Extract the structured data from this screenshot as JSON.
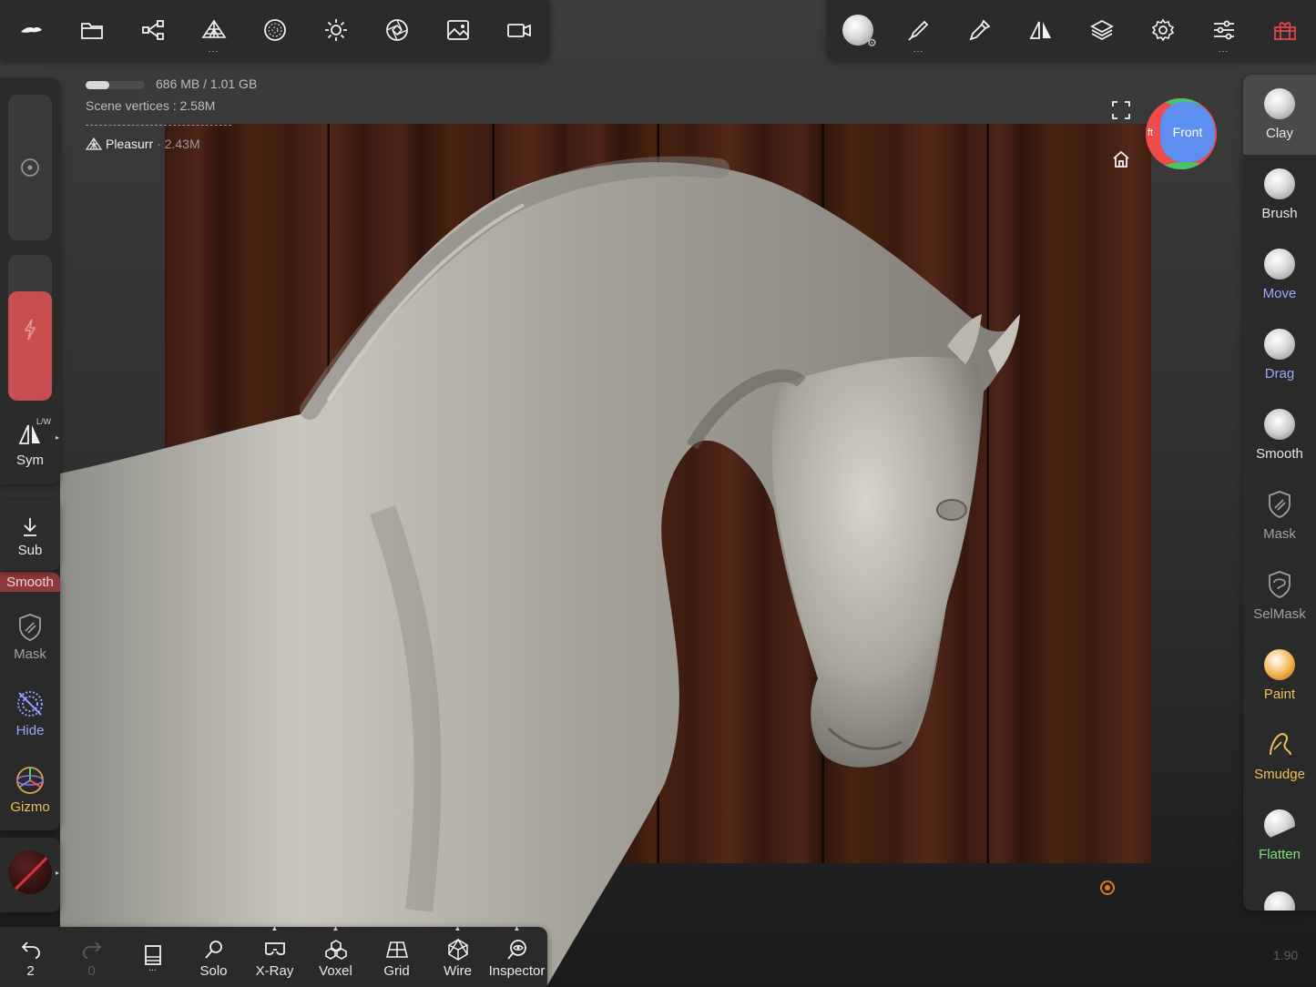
{
  "topbar_left": {
    "items": [
      {
        "name": "nomad-logo-icon"
      },
      {
        "name": "files-icon"
      },
      {
        "name": "scene-tree-icon"
      },
      {
        "name": "topology-icon",
        "more": "..."
      },
      {
        "name": "material-sphere-icon"
      },
      {
        "name": "lighting-icon"
      },
      {
        "name": "postprocess-icon"
      },
      {
        "name": "background-image-icon"
      },
      {
        "name": "camera-icon"
      }
    ]
  },
  "topbar_right": {
    "items": [
      {
        "name": "material-preview-icon"
      },
      {
        "name": "stroke-icon",
        "more": "..."
      },
      {
        "name": "paint-picker-icon"
      },
      {
        "name": "symmetry-icon"
      },
      {
        "name": "layers-icon"
      },
      {
        "name": "settings-icon"
      },
      {
        "name": "interface-sliders-icon",
        "more": "..."
      },
      {
        "name": "gift-icon"
      }
    ]
  },
  "info": {
    "memory": "686 MB / 1.01 GB",
    "memory_fraction": 0.4,
    "scene_vertices_label": "Scene vertices :",
    "scene_vertices_value": "2.58M",
    "mesh_name": "Pleasurr",
    "mesh_count": "· 2.43M"
  },
  "view_cube": {
    "front": "Front",
    "left": "ft"
  },
  "left_panel": {
    "sym": {
      "label": "Sym",
      "badge": "L/W"
    },
    "sub": {
      "label": "Sub"
    },
    "smooth_partial": "Smooth",
    "mask": {
      "label": "Mask"
    },
    "hide": {
      "label": "Hide"
    },
    "gizmo": {
      "label": "Gizmo"
    }
  },
  "right_tools": [
    {
      "label": "Clay",
      "color": "#e6e6e6",
      "active": true
    },
    {
      "label": "Brush",
      "color": "#e6e6e6"
    },
    {
      "label": "Move",
      "color": "#9aa8ff"
    },
    {
      "label": "Drag",
      "color": "#9aa8ff"
    },
    {
      "label": "Smooth",
      "color": "#e6e6e6"
    },
    {
      "label": "Mask",
      "color": "#a0a0a0"
    },
    {
      "label": "SelMask",
      "color": "#a0a0a0"
    },
    {
      "label": "Paint",
      "color": "#f0c050"
    },
    {
      "label": "Smudge",
      "color": "#f0c050"
    },
    {
      "label": "Flatten",
      "color": "#7ee07e"
    }
  ],
  "bottombar": {
    "undo": {
      "label": "2"
    },
    "redo": {
      "label": "0"
    },
    "history_more": "...",
    "solo": {
      "label": "Solo"
    },
    "xray": {
      "label": "X-Ray"
    },
    "voxel": {
      "label": "Voxel"
    },
    "grid": {
      "label": "Grid"
    },
    "wire": {
      "label": "Wire"
    },
    "inspector": {
      "label": "Inspector"
    }
  },
  "version": "1.90",
  "colors": {
    "accent_red": "#c84f4f",
    "move_blue": "#9aa8ff",
    "paint_yellow": "#f0c050",
    "flatten_green": "#7ee07e"
  }
}
